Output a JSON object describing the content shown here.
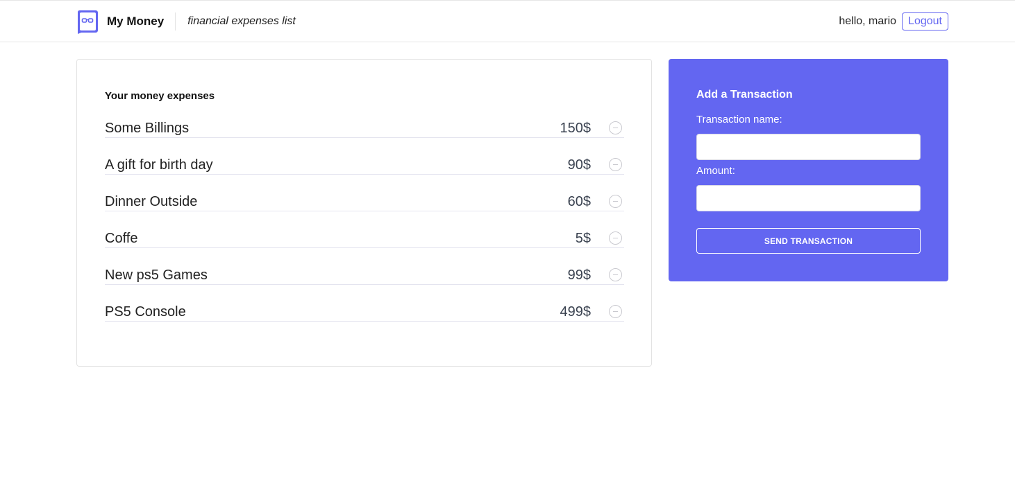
{
  "header": {
    "app_name": "My Money",
    "subtitle": "financial expenses list",
    "greeting": "hello, mario",
    "logout_label": "Logout"
  },
  "expenses": {
    "title": "Your money expenses",
    "items": [
      {
        "name": "Some Billings",
        "amount": "150$"
      },
      {
        "name": "A gift for birth day",
        "amount": "90$"
      },
      {
        "name": "Dinner Outside",
        "amount": "60$"
      },
      {
        "name": "Coffe",
        "amount": "5$"
      },
      {
        "name": "New ps5 Games",
        "amount": "99$"
      },
      {
        "name": "PS5 Console",
        "amount": "499$"
      }
    ]
  },
  "form": {
    "title": "Add a Transaction",
    "name_label": "Transaction name:",
    "name_value": "",
    "amount_label": "Amount:",
    "amount_value": "",
    "submit_label": "SEND TRANSACTION"
  },
  "colors": {
    "accent": "#6366f1",
    "border": "#e3e3e3"
  }
}
